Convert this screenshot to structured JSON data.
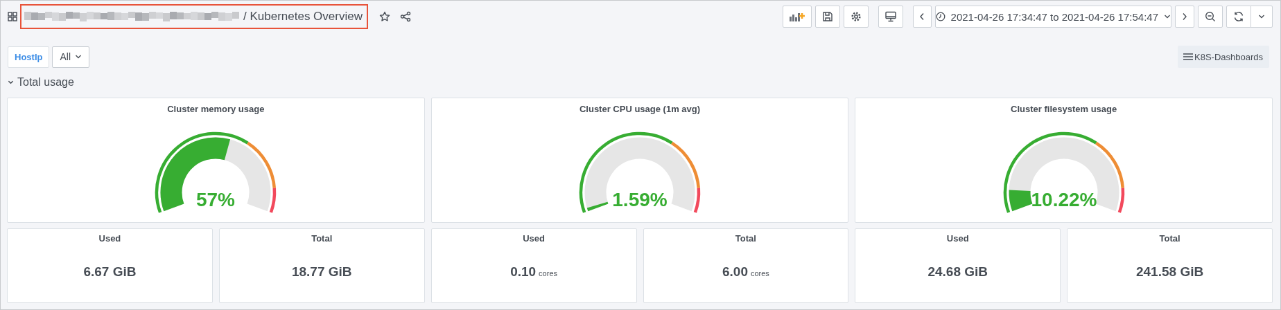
{
  "header": {
    "title": "/ Kubernetes Overview",
    "highlighted": true
  },
  "toolbar": {
    "time_range": "2021-04-26 17:34:47 to 2021-04-26 17:54:47"
  },
  "variables": [
    {
      "label": "HostIp",
      "value": "All"
    }
  ],
  "dashboard_link": "K8S-Dashboards",
  "row": {
    "title": "Total usage",
    "expanded": true
  },
  "gauges": [
    {
      "title": "Cluster memory usage",
      "value": "57%"
    },
    {
      "title": "Cluster CPU usage (1m avg)",
      "value": "1.59%"
    },
    {
      "title": "Cluster filesystem usage",
      "value": "10.22%"
    }
  ],
  "stats": [
    {
      "title": "Used",
      "value": "6.67 GiB"
    },
    {
      "title": "Total",
      "value": "18.77 GiB"
    },
    {
      "title": "Used",
      "value": "0.10",
      "unit": "cores"
    },
    {
      "title": "Total",
      "value": "6.00",
      "unit": "cores"
    },
    {
      "title": "Used",
      "value": "24.68 GiB"
    },
    {
      "title": "Total",
      "value": "241.58 GiB"
    }
  ]
}
